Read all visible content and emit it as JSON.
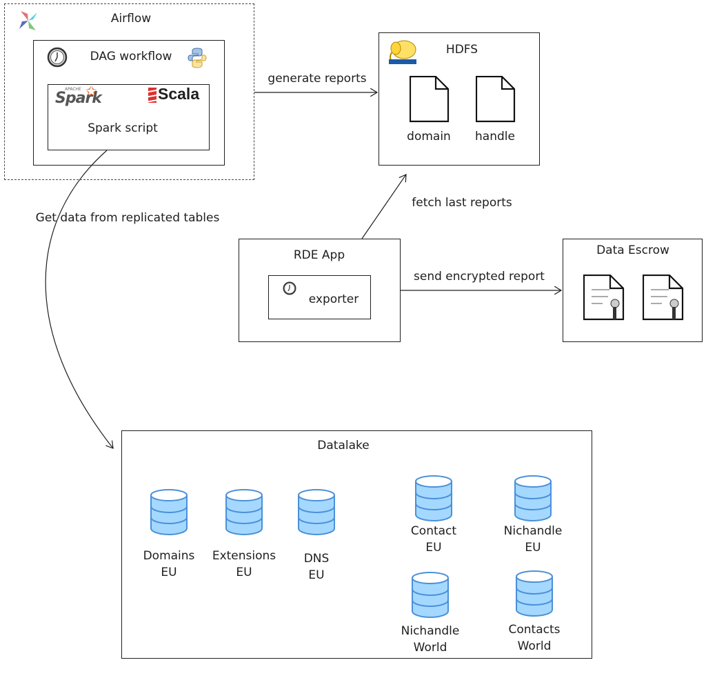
{
  "airflow": {
    "title": "Airflow",
    "logo": "airflow-pinwheel-icon"
  },
  "dag": {
    "title": "DAG workflow",
    "icons": [
      "clock-icon",
      "python-icon"
    ]
  },
  "spark_box": {
    "label": "Spark script",
    "spark_logo": "Spark",
    "spark_logo_small": "APACHE",
    "scala_logo": "Scala"
  },
  "hdfs": {
    "title": "HDFS",
    "logo": "hadoop-elephant-icon",
    "files": [
      "domain",
      "handle"
    ]
  },
  "rde": {
    "title": "RDE App",
    "exporter": "exporter"
  },
  "escrow": {
    "title": "Data Escrow",
    "icons": [
      "certificate-document-icon",
      "certificate-document-icon"
    ]
  },
  "arrows": {
    "generate": "generate reports",
    "fetch": "fetch last reports",
    "send": "send encrypted report",
    "get_data": "Get data from replicated tables"
  },
  "datalake": {
    "title": "Datalake",
    "databases": [
      {
        "line1": "Domains",
        "line2": "EU"
      },
      {
        "line1": "Extensions",
        "line2": "EU"
      },
      {
        "line1": "DNS",
        "line2": "EU"
      },
      {
        "line1": "Contact",
        "line2": "EU"
      },
      {
        "line1": "Nichandle",
        "line2": "EU"
      },
      {
        "line1": "Nichandle",
        "line2": "World"
      },
      {
        "line1": "Contacts",
        "line2": "World"
      }
    ]
  },
  "colors": {
    "db_blue": "#4a90d9",
    "db_fill": "#a5d8ff",
    "scala_red": "#dc322f",
    "spark_orange": "#e25a1c"
  }
}
